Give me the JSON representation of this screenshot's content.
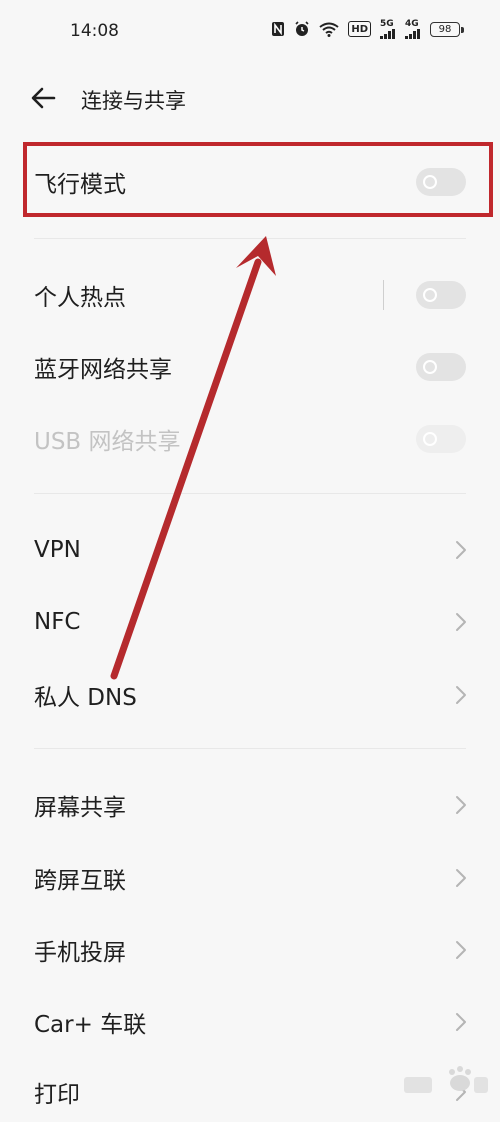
{
  "status_bar": {
    "time": "14:08",
    "icons": [
      "nfc-icon",
      "alarm-icon",
      "wifi-icon",
      "hd-icon",
      "5g-signal-icon",
      "4g-signal-icon",
      "battery-icon"
    ],
    "hd_label": "HD",
    "net1": "5G",
    "net2": "4G",
    "battery": "98"
  },
  "header": {
    "title": "连接与共享"
  },
  "rows": {
    "airplane": {
      "label": "飞行模式",
      "on": false
    },
    "hotspot": {
      "label": "个人热点",
      "on": false
    },
    "bt_tether": {
      "label": "蓝牙网络共享",
      "on": false
    },
    "usb_tether": {
      "label": "USB 网络共享",
      "on": false,
      "disabled": true
    },
    "vpn": {
      "label": "VPN"
    },
    "nfc": {
      "label": "NFC"
    },
    "dns": {
      "label": "私人 DNS"
    },
    "screen_share": {
      "label": "屏幕共享"
    },
    "cross_screen": {
      "label": "跨屏互联"
    },
    "cast": {
      "label": "手机投屏"
    },
    "car": {
      "label": "Car+ 车联"
    },
    "print": {
      "label": "打印"
    }
  },
  "annotation": {
    "color": "#c0282d"
  }
}
